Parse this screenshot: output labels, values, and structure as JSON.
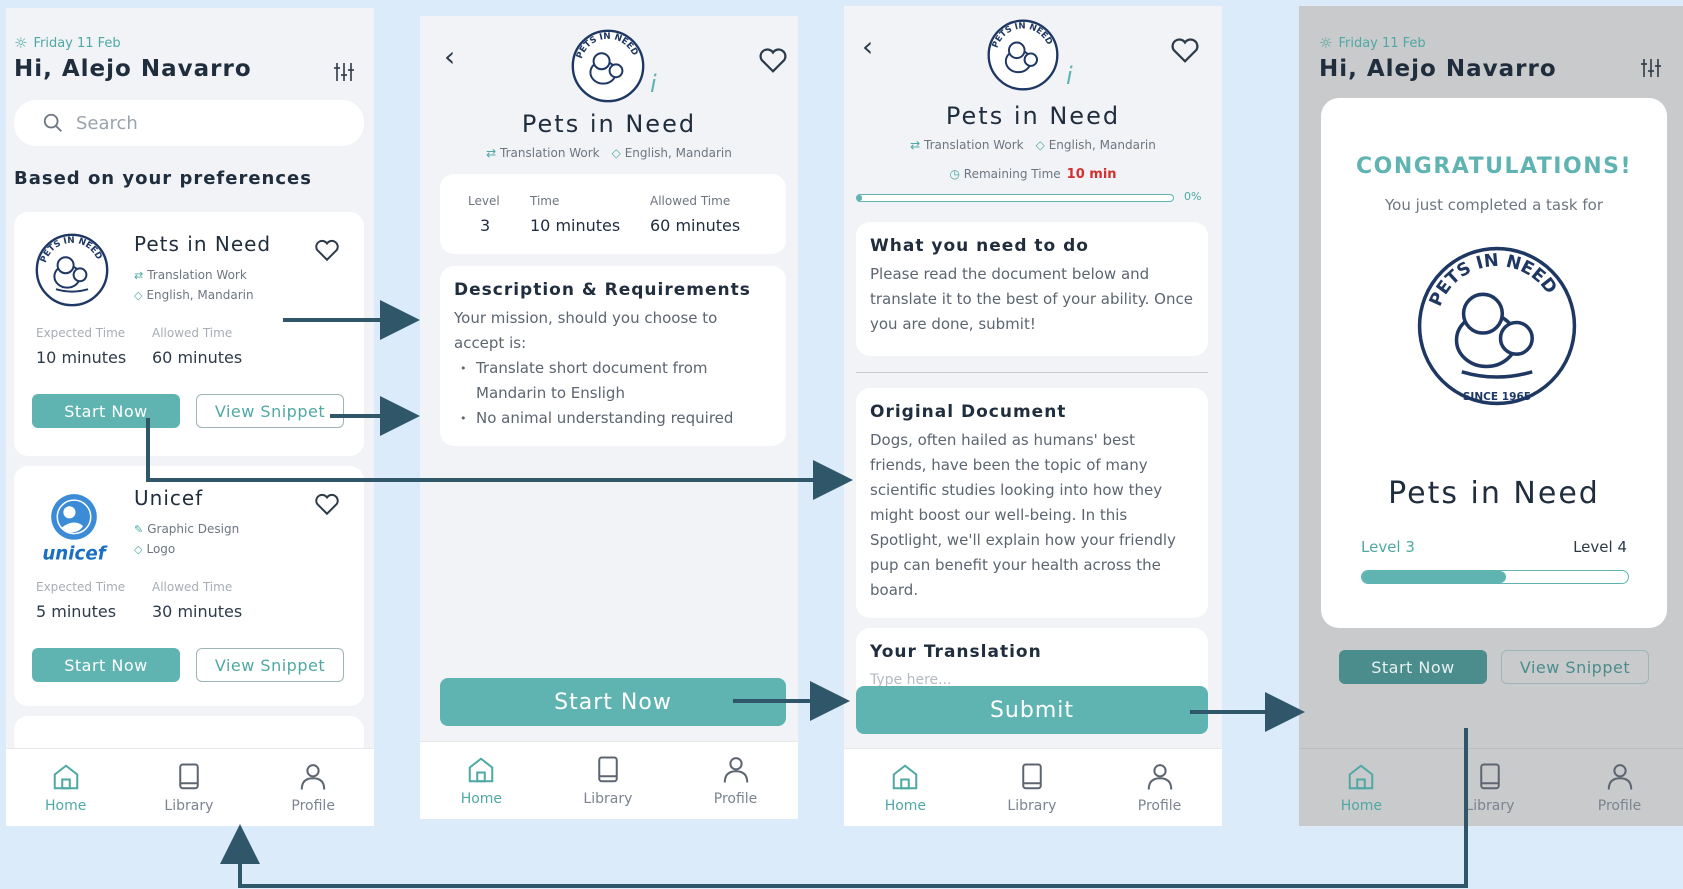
{
  "home": {
    "date": "Friday 11 Feb",
    "greeting": "Hi, Alejo Navarro",
    "search_placeholder": "Search",
    "section_title": "Based on your preferences",
    "cards": [
      {
        "name": "Pets in Need",
        "tag1": "Translation Work",
        "tag2": "English, Mandarin",
        "expected_label": "Expected Time",
        "expected_value": "10 minutes",
        "allowed_label": "Allowed Time",
        "allowed_value": "60 minutes",
        "start_label": "Start Now",
        "snippet_label": "View Snippet"
      },
      {
        "name": "Unicef",
        "tag1": "Graphic Design",
        "tag2": "Logo",
        "expected_label": "Expected Time",
        "expected_value": "5 minutes",
        "allowed_label": "Allowed Time",
        "allowed_value": "30 minutes",
        "start_label": "Start Now",
        "snippet_label": "View Snippet"
      }
    ]
  },
  "nav": {
    "home": "Home",
    "library": "Library",
    "profile": "Profile"
  },
  "detail": {
    "title": "Pets in Need",
    "tag1": "Translation Work",
    "tag2": "English, Mandarin",
    "level_label": "Level",
    "level_value": "3",
    "time_label": "Time",
    "time_value": "10 minutes",
    "allowed_label": "Allowed Time",
    "allowed_value": "60 minutes",
    "desc_title": "Description & Requirements",
    "desc_text": "Your mission, should you choose to accept is:",
    "bullet1": "Translate short document from Mandarin to Ensligh",
    "bullet2": "No animal understanding required",
    "start_label": "Start Now"
  },
  "task": {
    "title": "Pets in Need",
    "tag1": "Translation Work",
    "tag2": "English, Mandarin",
    "remaining_label": "Remaining Time",
    "remaining_value": "10 min",
    "progress_text": "0%",
    "progress": 0,
    "todo_title": "What you need to do",
    "todo_text": "Please read the document below and translate it to the best of your ability. Once you are done, submit!",
    "orig_title": "Original Document",
    "orig_text": "Dogs, often hailed as humans' best friends, have been the topic of many scientific studies looking into how they might boost our well-being. In this Spotlight, we'll explain how your friendly pup can benefit your health across the board.",
    "translation_title": "Your Translation",
    "translation_placeholder": "Type here...",
    "submit_label": "Submit"
  },
  "congrats": {
    "date": "Friday 11 Feb",
    "greeting": "Hi, Alejo Navarro",
    "heading": "CONGRATULATIONS!",
    "subtext": "You just completed a task for",
    "org": "Pets in Need",
    "level_from": "Level 3",
    "level_to": "Level 4",
    "level_progress": 0.54,
    "start_label": "Start Now",
    "snippet_label": "View Snippet"
  },
  "logo": {
    "top_text": "PETS IN NEED",
    "bottom_text": "SINCE 1965"
  },
  "unicef_logo": {
    "text": "unicef"
  },
  "colors": {
    "accent": "#5fb4b2",
    "arrow": "#2f5669",
    "background": "#dcebfa",
    "remaining": "#d32f2f"
  }
}
